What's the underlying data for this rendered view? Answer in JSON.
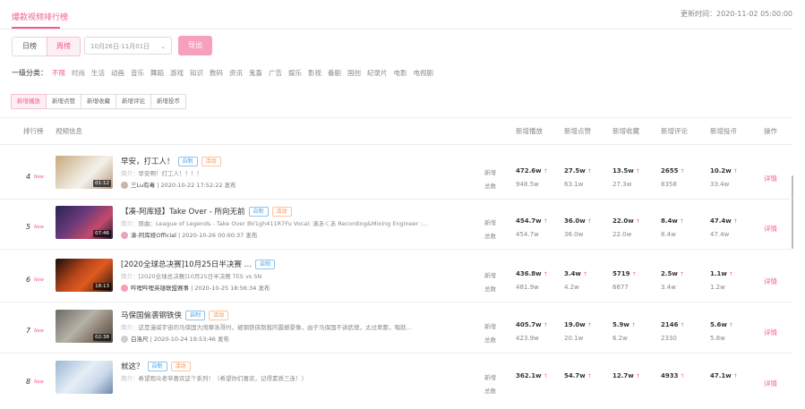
{
  "tab_title": "爆款视频排行榜",
  "update_time": "更新时间：2020-11-02 05:00:00",
  "period": {
    "daily": "日榜",
    "weekly": "周榜"
  },
  "date_range": "10月26日-11月01日",
  "export_label": "导出",
  "category_label": "一级分类：",
  "categories": [
    "不限",
    "时尚",
    "生活",
    "动画",
    "音乐",
    "舞蹈",
    "游戏",
    "知识",
    "数码",
    "资讯",
    "鬼畜",
    "广告",
    "娱乐",
    "影视",
    "番剧",
    "国创",
    "纪录片",
    "电影",
    "电视剧"
  ],
  "sort_tabs": [
    "新增播放",
    "新增点赞",
    "新增收藏",
    "新增评论",
    "新增投币"
  ],
  "headers": {
    "rank": "排行榜",
    "video": "视频信息",
    "play": "新增播放",
    "like": "新增点赞",
    "fav": "新增收藏",
    "comment": "新增评论",
    "coin": "新增投币",
    "action": "操作"
  },
  "labels": {
    "new": "新增",
    "total": "总数",
    "intro": "简介：",
    "publish": "发布",
    "detail": "详情",
    "new_badge": "New"
  },
  "rows": [
    {
      "rank": "4",
      "duration": "01:12",
      "title": "早安，打工人！",
      "tags": [
        "自制",
        "活动"
      ],
      "desc": "早安啊！打工人！！！！",
      "author": "三Lu有毒",
      "date": "2020-10-22 17:52:22",
      "new": {
        "play": "472.6w",
        "like": "27.5w",
        "fav": "13.5w",
        "comment": "2655",
        "coin": "10.2w"
      },
      "total": {
        "play": "948.5w",
        "like": "63.1w",
        "fav": "27.3w",
        "comment": "8358",
        "coin": "33.4w"
      }
    },
    {
      "rank": "5",
      "duration": "07:46",
      "title": "【凑-阿库娅】Take Over - 所向无前",
      "tags": [
        "自制",
        "活动"
      ],
      "desc": "原曲：League of Legends - Take Over BV1gh411R7Fu Vocal: 湊あくあ Recording&Mixing Engineer :…",
      "author": "湊-阿库娅Official",
      "date": "2020-10-26 00:00:37",
      "new": {
        "play": "454.7w",
        "like": "36.0w",
        "fav": "22.0w",
        "comment": "8.4w",
        "coin": "47.4w"
      },
      "total": {
        "play": "454.7w",
        "like": "36.0w",
        "fav": "22.0w",
        "comment": "8.4w",
        "coin": "47.4w"
      }
    },
    {
      "rank": "6",
      "duration": "18:13",
      "title": "[2020全球总决赛]10月25日半决赛 …",
      "tags": [
        "自制"
      ],
      "desc": "[2020全球总决赛]10月25日半决赛 TES vs SN",
      "author": "哔哩哔哩英雄联盟赛事",
      "date": "2020-10-25 18:56:34",
      "new": {
        "play": "436.8w",
        "like": "3.4w",
        "fav": "5719",
        "comment": "2.5w",
        "coin": "1.1w"
      },
      "total": {
        "play": "481.9w",
        "like": "4.2w",
        "fav": "6677",
        "comment": "3.4w",
        "coin": "1.2w"
      }
    },
    {
      "rank": "7",
      "duration": "02:38",
      "title": "马保国偷袭钢铁侠",
      "tags": [
        "自制",
        "活动"
      ],
      "desc": "这是漫威宇宙的马保国大闹摩洛哥时，被钢铁侠制裁的震撼景像，由于马保国不讲武德，太过卑鄙，唱就…",
      "author": "白洛尺",
      "date": "2020-10-24 19:53:46",
      "new": {
        "play": "405.7w",
        "like": "19.0w",
        "fav": "5.9w",
        "comment": "2146",
        "coin": "5.6w"
      },
      "total": {
        "play": "423.9w",
        "like": "20.1w",
        "fav": "6.2w",
        "comment": "2330",
        "coin": "5.8w"
      }
    },
    {
      "rank": "8",
      "duration": "",
      "title": "就这？",
      "tags": [
        "自制",
        "活动"
      ],
      "desc": "希望观众老爷喜欢这个系列！（希望你们喜欢，记得素质三连！）",
      "author": "",
      "date": "",
      "new": {
        "play": "362.1w",
        "like": "54.7w",
        "fav": "12.7w",
        "comment": "4933",
        "coin": "47.1w"
      },
      "total": {
        "play": "",
        "like": "",
        "fav": "",
        "comment": "",
        "coin": ""
      }
    }
  ],
  "colors": {
    "accent": "#f25d8e",
    "tag_blue": "#4aa2e8",
    "tag_orange": "#ff8a3d"
  }
}
